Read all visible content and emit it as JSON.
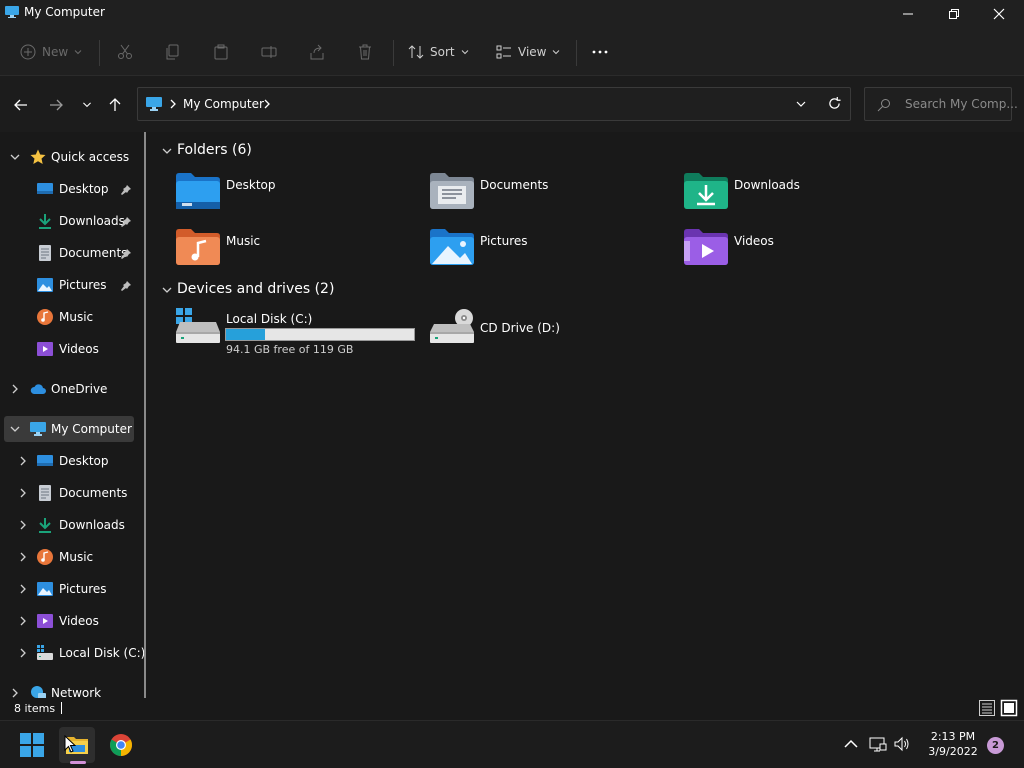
{
  "window": {
    "title": "My Computer"
  },
  "toolbar": {
    "new_label": "New",
    "sort_label": "Sort",
    "view_label": "View"
  },
  "address": {
    "crumbs": [
      "My Computer"
    ],
    "search_placeholder": "Search My Comp..."
  },
  "sidebar": {
    "quick_access": "Quick access",
    "quick_items": [
      {
        "label": "Desktop",
        "pinned": true
      },
      {
        "label": "Downloads",
        "pinned": true
      },
      {
        "label": "Documents",
        "pinned": true
      },
      {
        "label": "Pictures",
        "pinned": true
      },
      {
        "label": "Music",
        "pinned": false
      },
      {
        "label": "Videos",
        "pinned": false
      }
    ],
    "onedrive": "OneDrive",
    "my_computer": "My Computer",
    "computer_items": [
      "Desktop",
      "Documents",
      "Downloads",
      "Music",
      "Pictures",
      "Videos",
      "Local Disk (C:)"
    ],
    "network": "Network"
  },
  "main": {
    "folders_header": "Folders (6)",
    "folders": [
      "Desktop",
      "Documents",
      "Downloads",
      "Music",
      "Pictures",
      "Videos"
    ],
    "devices_header": "Devices and drives (2)",
    "drives": [
      {
        "name": "Local Disk (C:)",
        "free_text": "94.1 GB free of 119 GB",
        "used_fraction": 0.21
      },
      {
        "name": "CD Drive (D:)"
      }
    ]
  },
  "status": {
    "item_count": "8 items"
  },
  "taskbar": {
    "time": "2:13 PM",
    "date": "3/9/2022",
    "notifications": "2"
  },
  "colors": {
    "accent": "#26a0da",
    "folder_blue": "#2d8fe0",
    "folder_green": "#1aa37a",
    "folder_orange": "#e8763a",
    "folder_purple": "#8c4fd6",
    "star": "#f5c242"
  }
}
